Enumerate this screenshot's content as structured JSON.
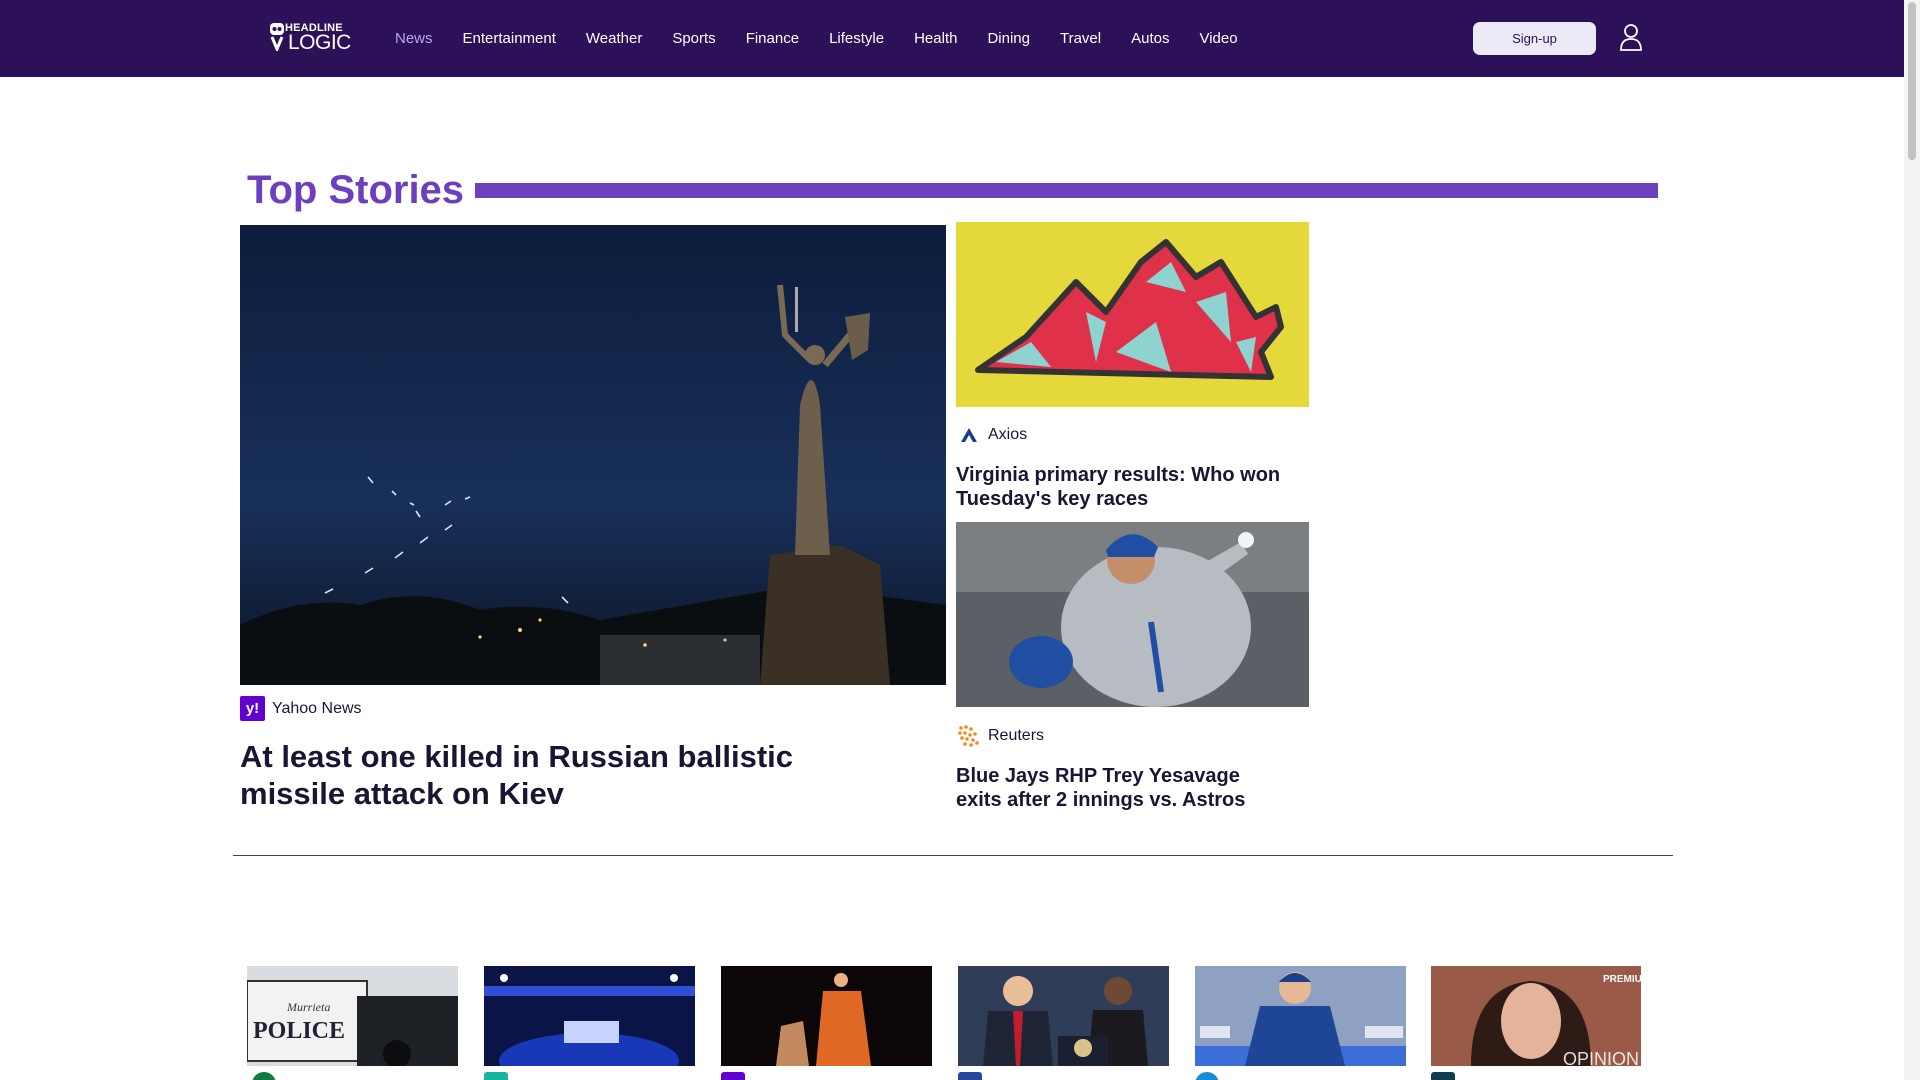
{
  "header": {
    "logo_top": "HEADLINE",
    "logo_bottom": "LOGIC",
    "nav": [
      "News",
      "Entertainment",
      "Weather",
      "Sports",
      "Finance",
      "Lifestyle",
      "Health",
      "Dining",
      "Travel",
      "Autos",
      "Video"
    ],
    "active_nav": "News",
    "signup_label": "Sign-up"
  },
  "top_stories": {
    "title": "Top Stories",
    "main": {
      "source": "Yahoo News",
      "headline": "At least one killed in Russian ballistic missile attack on Kiev"
    },
    "side": [
      {
        "source": "Axios",
        "headline": "Virginia primary results: Who won Tuesday's key races"
      },
      {
        "source": "Reuters",
        "headline": "Blue Jays RHP Trey Yesavage exits after 2 innings vs. Astros"
      }
    ]
  },
  "thumb_strip": {
    "police_text": "POLICE",
    "police_sub": "Murrieta",
    "premium_text": "PREMIUM",
    "opinion_text": "OPINION"
  },
  "colors": {
    "header_bg": "#2d1158",
    "accent": "#6d3fbf",
    "text": "#1c1433"
  }
}
